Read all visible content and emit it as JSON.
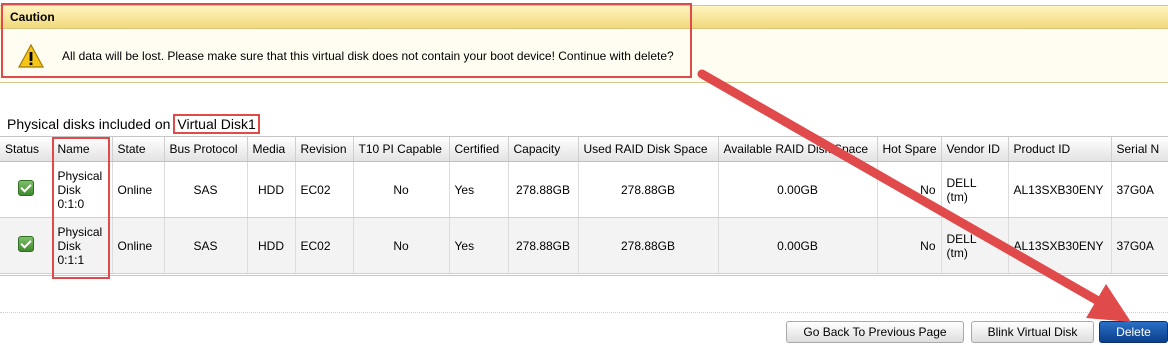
{
  "caution": {
    "title": "Caution",
    "message": "All data will be lost. Please make sure that this virtual disk does not contain your boot device! Continue with delete?"
  },
  "physical_disks": {
    "title_prefix": "Physical disks included on",
    "virtual_disk_name": "Virtual Disk1"
  },
  "table": {
    "columns": [
      "Status",
      "Name",
      "State",
      "Bus Protocol",
      "Media",
      "Revision",
      "T10 PI Capable",
      "Certified",
      "Capacity",
      "Used RAID Disk Space",
      "Available RAID Disk Space",
      "Hot Spare",
      "Vendor ID",
      "Product ID",
      "Serial N"
    ],
    "rows": [
      {
        "name_line1": "Physical",
        "name_line2": "Disk",
        "name_line3": "0:1:0",
        "state": "Online",
        "bus": "SAS",
        "media": "HDD",
        "revision": "EC02",
        "t10": "No",
        "certified": "Yes",
        "capacity": "278.88GB",
        "used": "278.88GB",
        "available": "0.00GB",
        "hot_spare": "No",
        "vendor_line1": "DELL",
        "vendor_line2": "(tm)",
        "product": "AL13SXB30ENY",
        "serial": "37G0A"
      },
      {
        "name_line1": "Physical",
        "name_line2": "Disk",
        "name_line3": "0:1:1",
        "state": "Online",
        "bus": "SAS",
        "media": "HDD",
        "revision": "EC02",
        "t10": "No",
        "certified": "Yes",
        "capacity": "278.88GB",
        "used": "278.88GB",
        "available": "0.00GB",
        "hot_spare": "No",
        "vendor_line1": "DELL",
        "vendor_line2": "(tm)",
        "product": "AL13SXB30ENY",
        "serial": "37G0A"
      }
    ]
  },
  "buttons": {
    "back": "Go Back To Previous Page",
    "blink": "Blink Virtual Disk",
    "delete": "Delete"
  },
  "colors": {
    "highlight": "#e04a4a",
    "delete_button": "#0c3f8a"
  },
  "icons": {
    "warning": "warning-icon",
    "status": "status-ok-icon"
  }
}
